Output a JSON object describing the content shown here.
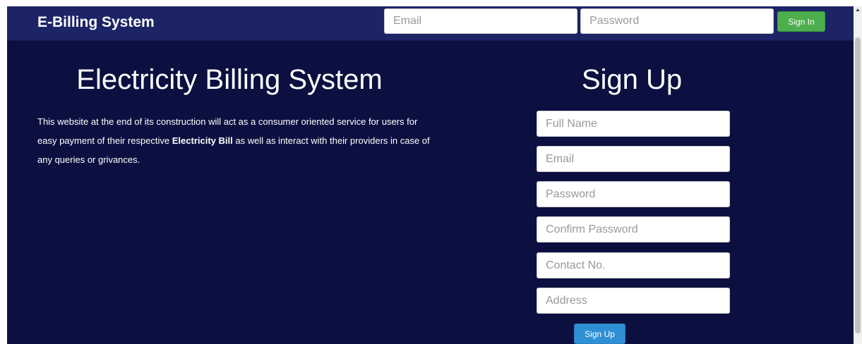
{
  "navbar": {
    "brand": "E-Billing System",
    "email_placeholder": "Email",
    "password_placeholder": "Password",
    "signin_label": "Sign In"
  },
  "hero": {
    "title": "Electricity Billing System",
    "description_part1": "This website at the end of its construction will act as a consumer oriented service for users for easy payment of their respective ",
    "description_bold": "Electricity Bill",
    "description_part2": " as well as interact with their providers in case of any queries or grivances."
  },
  "signup": {
    "title": "Sign Up",
    "fields": {
      "full_name": "Full Name",
      "email": "Email",
      "password": "Password",
      "confirm_password": "Confirm Password",
      "contact": "Contact No.",
      "address": "Address"
    },
    "button_label": "Sign Up"
  },
  "colors": {
    "page_background": "#0c1040",
    "navbar_background": "#1c2466",
    "signin_button": "#4cae4c",
    "signup_button": "#2e8fd4"
  }
}
